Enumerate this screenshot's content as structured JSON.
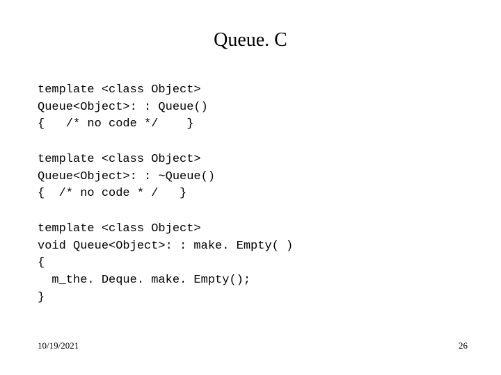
{
  "title": "Queue. C",
  "code": {
    "block1": "template <class Object>\nQueue<Object>: : Queue()\n{   /* no code */    }",
    "block2": "template <class Object>\nQueue<Object>: : ~Queue()\n{  /* no code * /   }",
    "block3": "template <class Object>\nvoid Queue<Object>: : make. Empty( )\n{\n  m_the. Deque. make. Empty();\n}"
  },
  "footer": {
    "date": "10/19/2021",
    "page": "26"
  }
}
